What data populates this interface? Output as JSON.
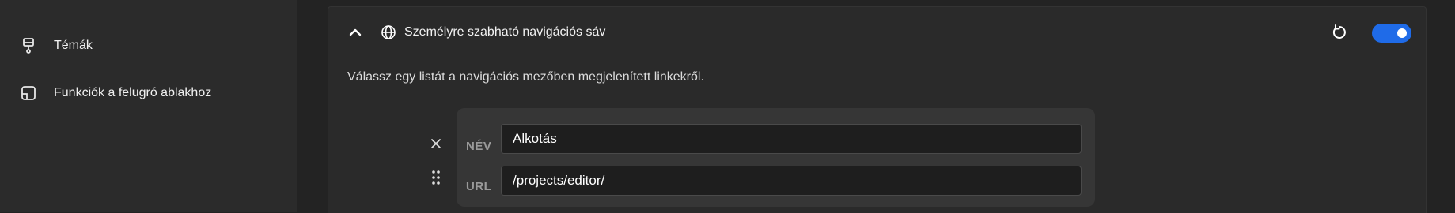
{
  "sidebar": {
    "items": [
      {
        "label": "Témák",
        "icon": "brush-icon"
      },
      {
        "label": "Funkciók a felugró ablakhoz",
        "icon": "popup-window-icon"
      }
    ]
  },
  "card": {
    "title": "Személyre szabható navigációs sáv",
    "description": "Válassz egy listát a navigációs mezőben megjelenített linkekről.",
    "toggle_on": true,
    "accent_color": "#1f6be8"
  },
  "entry": {
    "name_label": "NÉV",
    "name_value": "Alkotás",
    "url_label": "URL",
    "url_value": "/projects/editor/"
  }
}
